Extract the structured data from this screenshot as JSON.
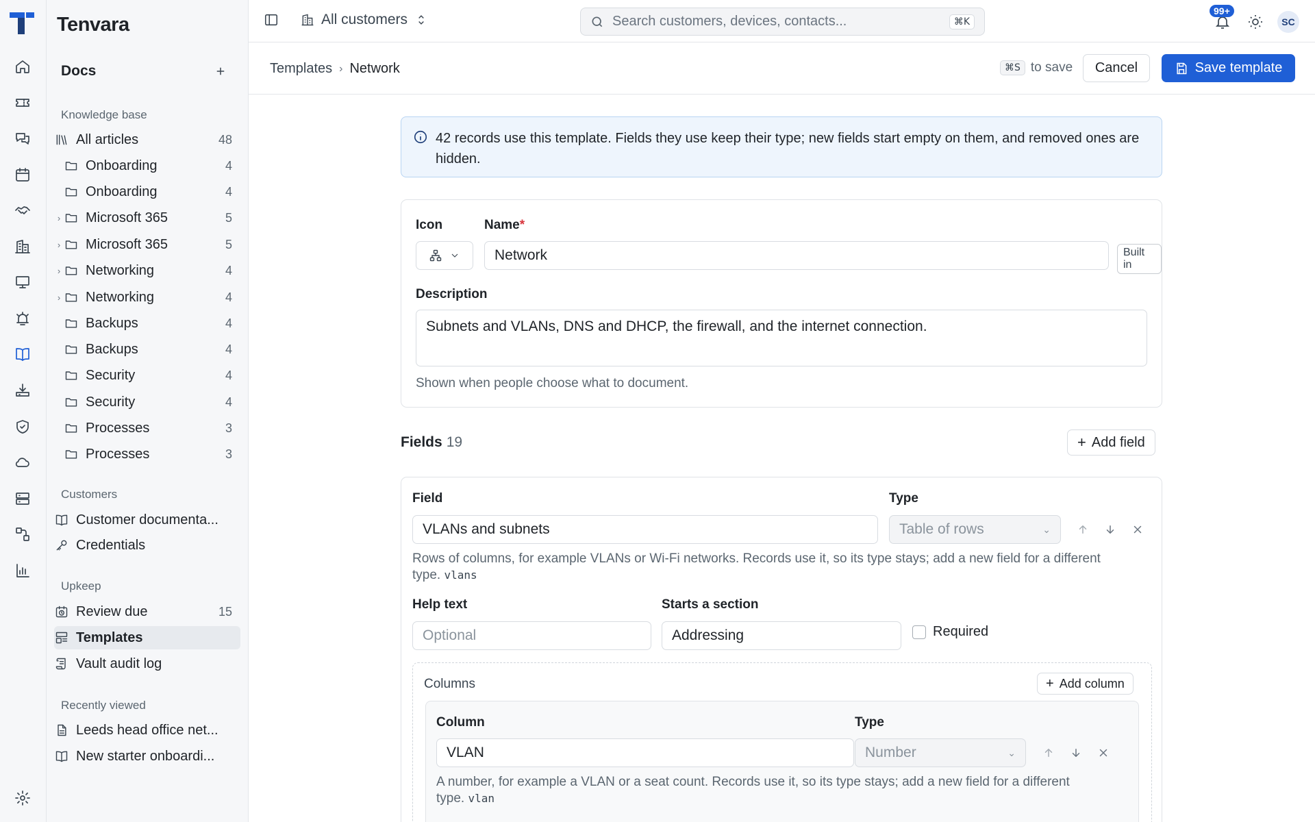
{
  "app": {
    "name": "Tenvara",
    "brand_color": "#1f5fd6"
  },
  "rail": {
    "icons": [
      "home-icon",
      "ticket-icon",
      "chat-icon",
      "calendar-icon",
      "handshake-icon",
      "building-icon",
      "monitor-icon",
      "alarm-icon",
      "book-icon",
      "download-tray-icon",
      "shield-check-icon",
      "cloud-icon",
      "server-icon",
      "workflow-icon",
      "bar-chart-icon"
    ],
    "settings_icon": "settings-icon"
  },
  "sidebar": {
    "title": "Docs",
    "knowledge_base_label": "Knowledge base",
    "kb_items": [
      {
        "label": "All articles",
        "count": "48"
      },
      {
        "label": "Onboarding",
        "count": "4"
      },
      {
        "label": "Onboarding",
        "count": "4"
      },
      {
        "label": "Microsoft 365",
        "count": "5"
      },
      {
        "label": "Microsoft 365",
        "count": "5"
      },
      {
        "label": "Networking",
        "count": "4"
      },
      {
        "label": "Networking",
        "count": "4"
      },
      {
        "label": "Backups",
        "count": "4"
      },
      {
        "label": "Backups",
        "count": "4"
      },
      {
        "label": "Security",
        "count": "4"
      },
      {
        "label": "Security",
        "count": "4"
      },
      {
        "label": "Processes",
        "count": "3"
      },
      {
        "label": "Processes",
        "count": "3"
      }
    ],
    "customers_label": "Customers",
    "customer_items": [
      {
        "label": "Customer documenta..."
      },
      {
        "label": "Credentials"
      }
    ],
    "upkeep_label": "Upkeep",
    "upkeep_items": [
      {
        "label": "Review due",
        "count": "15"
      },
      {
        "label": "Templates"
      },
      {
        "label": "Vault audit log"
      }
    ],
    "recent_label": "Recently viewed",
    "recent_items": [
      {
        "label": "Leeds head office net..."
      },
      {
        "label": "New starter onboardi..."
      }
    ]
  },
  "topbar": {
    "customer_scope": "All customers",
    "search_placeholder": "Search customers, devices, contacts...",
    "search_shortcut": "⌘K",
    "notifications_badge": "99+",
    "avatar_initials": "SC"
  },
  "subbar": {
    "breadcrumb_parent": "Templates",
    "breadcrumb_current": "Network",
    "save_shortcut": "⌘S",
    "save_hint": "to save",
    "cancel_label": "Cancel",
    "save_label": "Save template"
  },
  "info_banner": "42 records use this template. Fields they use keep their type; new fields start empty on them, and removed ones are hidden.",
  "template": {
    "icon_label": "Icon",
    "name_label": "Name",
    "name_required_mark": "*",
    "name_value": "Network",
    "builtin_badge": "Built in",
    "description_label": "Description",
    "description_value": "Subnets and VLANs, DNS and DHCP, the firewall, and the internet connection.",
    "description_hint": "Shown when people choose what to document."
  },
  "fields": {
    "title": "Fields",
    "count": "19",
    "add_label": "Add field",
    "first": {
      "field_label": "Field",
      "field_value": "VLANs and subnets",
      "type_label": "Type",
      "type_value": "Table of rows",
      "hint": "Rows of columns, for example VLANs or Wi-Fi networks. Records use it, so its type stays; add a new field for a different type.",
      "key": "vlans",
      "help_label": "Help text",
      "help_placeholder": "Optional",
      "section_label": "Starts a section",
      "section_value": "Addressing",
      "required_label": "Required",
      "columns_title": "Columns",
      "add_column_label": "Add column",
      "column": {
        "column_label": "Column",
        "column_value": "VLAN",
        "type_label": "Type",
        "type_value": "Number",
        "hint": "A number, for example a VLAN or a seat count. Records use it, so its type stays; add a new field for a different type.",
        "key": "vlan"
      }
    }
  }
}
